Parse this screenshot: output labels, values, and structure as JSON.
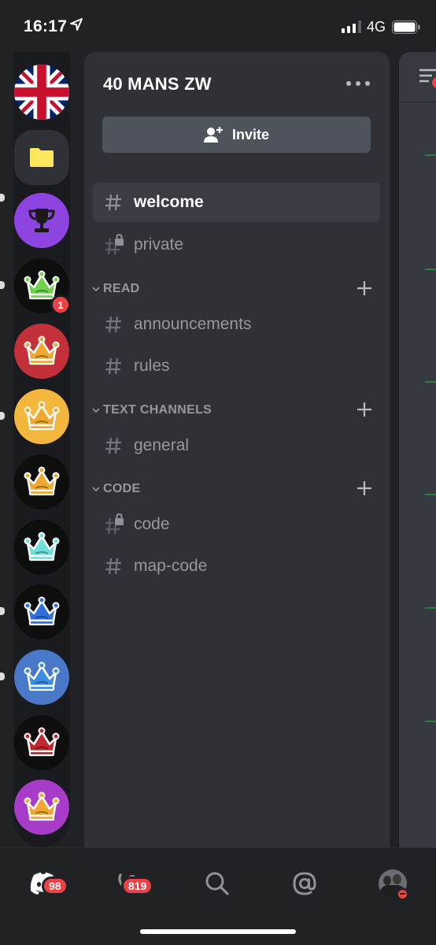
{
  "status_bar": {
    "time": "16:17",
    "network": "4G"
  },
  "server_rail": {
    "servers": [
      {
        "icon": "union-jack-icon"
      },
      {
        "icon": "folder-icon"
      },
      {
        "icon": "trophy-icon"
      },
      {
        "icon": "crown-icon-green",
        "mention_badge": "1"
      },
      {
        "icon": "crown-icon-gold-red"
      },
      {
        "icon": "crown-icon-gold-yellow"
      },
      {
        "icon": "crown-icon-gold-black"
      },
      {
        "icon": "crown-icon-cyan"
      },
      {
        "icon": "crown-icon-blue-black"
      },
      {
        "icon": "crown-icon-blue"
      },
      {
        "icon": "crown-icon-red-black"
      },
      {
        "icon": "crown-icon-gold-purple"
      }
    ]
  },
  "panel": {
    "server_name": "40 MANS ZW",
    "invite_label": "Invite",
    "channels_top": [
      {
        "name": "welcome",
        "active": true,
        "locked": false
      },
      {
        "name": "private",
        "active": false,
        "locked": true
      }
    ],
    "categories": [
      {
        "name": "READ",
        "channels": [
          {
            "name": "announcements",
            "locked": false
          },
          {
            "name": "rules",
            "locked": false
          }
        ]
      },
      {
        "name": "TEXT CHANNELS",
        "channels": [
          {
            "name": "general",
            "locked": false
          }
        ]
      },
      {
        "name": "CODE",
        "channels": [
          {
            "name": "code",
            "locked": true
          },
          {
            "name": "map-code",
            "locked": false
          }
        ]
      }
    ]
  },
  "bottom_nav": {
    "home_badge": "98",
    "friends_badge": "819"
  },
  "colors": {
    "background": "#202225",
    "panel": "#2f3136",
    "active_channel": "#393c43",
    "badge": "#ed4245",
    "muted_text": "#96989d"
  }
}
